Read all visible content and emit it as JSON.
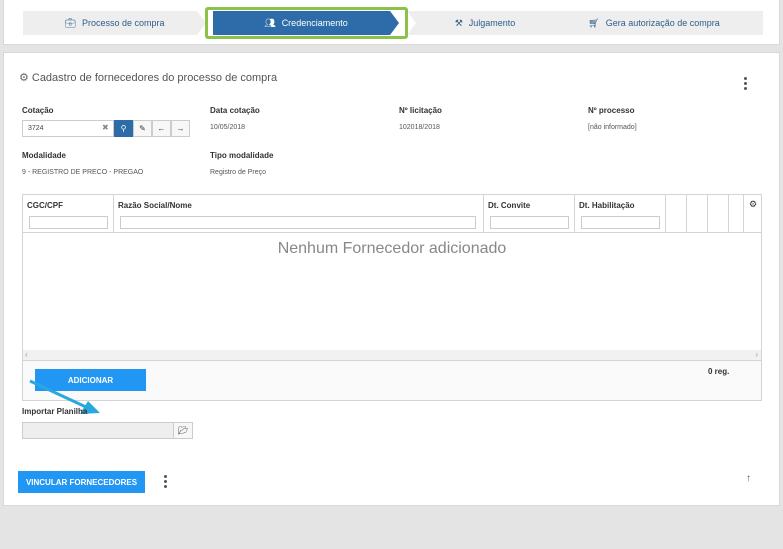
{
  "wizard": {
    "steps": [
      {
        "label": "Processo de compra",
        "icon": "briefcase-icon"
      },
      {
        "label": "Credenciamento",
        "icon": "users-icon"
      },
      {
        "label": "Julgamento",
        "icon": "gavel-icon"
      },
      {
        "label": "Gera autorização de compra",
        "icon": "cart-icon"
      }
    ],
    "active_index": 1
  },
  "page": {
    "title": "Cadastro de fornecedores do processo de compra",
    "title_icon": "gears-icon"
  },
  "form": {
    "cotacao": {
      "label": "Cotação",
      "value": "3724"
    },
    "data_cotacao": {
      "label": "Data cotação",
      "value": "10/05/2018"
    },
    "licitacao": {
      "label": "Nº licitação",
      "value": "102018/2018"
    },
    "processo": {
      "label": "Nº processo",
      "value": "[não informado]"
    },
    "modalidade": {
      "label": "Modalidade",
      "value": "9 - REGISTRO DE PRECO - PREGAO"
    },
    "tipo_modalidade": {
      "label": "Tipo modalidade",
      "value": "Registro de Preço"
    }
  },
  "grid": {
    "columns": [
      "CGC/CPF",
      "Razão Social/Nome",
      "Dt. Convite",
      "Dt. Habilitação"
    ],
    "empty_message": "Nenhum Fornecedor adicionado",
    "count": "0 reg."
  },
  "buttons": {
    "adicionar": "ADICIONAR",
    "vincular": "VINCULAR FORNECEDORES"
  },
  "import": {
    "label": "Importar Planilha"
  },
  "colors": {
    "primary": "#2d6ca8",
    "button": "#2196f3",
    "highlight": "#8bc34a",
    "pointer": "#29a8e0"
  }
}
